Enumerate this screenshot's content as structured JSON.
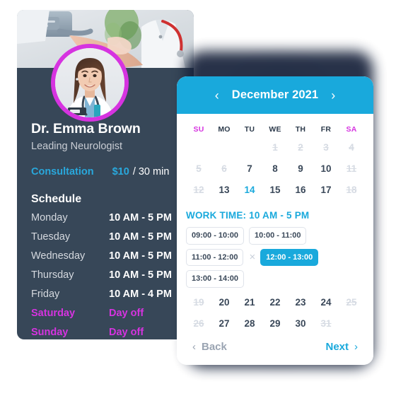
{
  "doctor": {
    "name": "Dr. Emma Brown",
    "role": "Leading Neurologist",
    "banner_alt": "doctor-measuring-blood-pressure-photo",
    "avatar_alt": "doctor-portrait-photo",
    "consultation_label": "Consultation",
    "consultation_price": "$10",
    "consultation_unit": "/ 30 min",
    "schedule_title": "Schedule",
    "schedule": [
      {
        "day": "Monday",
        "hours": "10 AM - 5 PM",
        "off": false
      },
      {
        "day": "Tuesday",
        "hours": "10 AM - 5 PM",
        "off": false
      },
      {
        "day": "Wednesday",
        "hours": "10 AM - 5 PM",
        "off": false
      },
      {
        "day": "Thursday",
        "hours": "10 AM - 5 PM",
        "off": false
      },
      {
        "day": "Friday",
        "hours": "10 AM - 4 PM",
        "off": false
      },
      {
        "day": "Saturday",
        "hours": "Day off",
        "off": true
      },
      {
        "day": "Sunday",
        "hours": "Day off",
        "off": true
      }
    ]
  },
  "calendar": {
    "title": "December 2021",
    "prev_icon": "‹",
    "next_icon": "›",
    "weekdays": [
      {
        "label": "SU",
        "weekend": true
      },
      {
        "label": "MO",
        "weekend": false
      },
      {
        "label": "TU",
        "weekend": false
      },
      {
        "label": "WE",
        "weekend": false
      },
      {
        "label": "TH",
        "weekend": false
      },
      {
        "label": "FR",
        "weekend": false
      },
      {
        "label": "SA",
        "weekend": true
      }
    ],
    "weeks_top": [
      [
        {
          "d": "",
          "state": "empty"
        },
        {
          "d": "",
          "state": "empty"
        },
        {
          "d": "",
          "state": "empty"
        },
        {
          "d": "1",
          "state": "disabled"
        },
        {
          "d": "2",
          "state": "disabled"
        },
        {
          "d": "3",
          "state": "disabled"
        },
        {
          "d": "4",
          "state": "disabled"
        }
      ],
      [
        {
          "d": "5",
          "state": "disabled"
        },
        {
          "d": "6",
          "state": "disabled"
        },
        {
          "d": "7",
          "state": "normal"
        },
        {
          "d": "8",
          "state": "normal"
        },
        {
          "d": "9",
          "state": "normal"
        },
        {
          "d": "10",
          "state": "normal"
        },
        {
          "d": "11",
          "state": "disabled"
        }
      ],
      [
        {
          "d": "12",
          "state": "disabled"
        },
        {
          "d": "13",
          "state": "normal"
        },
        {
          "d": "14",
          "state": "selected"
        },
        {
          "d": "15",
          "state": "normal"
        },
        {
          "d": "16",
          "state": "normal"
        },
        {
          "d": "17",
          "state": "normal"
        },
        {
          "d": "18",
          "state": "disabled"
        }
      ]
    ],
    "weeks_bottom": [
      [
        {
          "d": "19",
          "state": "disabled"
        },
        {
          "d": "20",
          "state": "normal"
        },
        {
          "d": "21",
          "state": "normal"
        },
        {
          "d": "22",
          "state": "normal"
        },
        {
          "d": "23",
          "state": "normal"
        },
        {
          "d": "24",
          "state": "normal"
        },
        {
          "d": "25",
          "state": "disabled"
        }
      ],
      [
        {
          "d": "26",
          "state": "disabled"
        },
        {
          "d": "27",
          "state": "normal"
        },
        {
          "d": "28",
          "state": "normal"
        },
        {
          "d": "29",
          "state": "normal"
        },
        {
          "d": "30",
          "state": "normal"
        },
        {
          "d": "31",
          "state": "disabled"
        },
        {
          "d": "",
          "state": "empty"
        }
      ]
    ],
    "worktime_label": "WORK TIME: 10 AM - 5 PM",
    "slots": [
      {
        "label": "09:00 - 10:00",
        "active": false
      },
      {
        "label": "10:00 - 11:00",
        "active": false
      },
      {
        "label": "11:00 - 12:00",
        "active": false
      },
      {
        "label": "12:00 - 13:00",
        "active": true
      },
      {
        "label": "13:00 - 14:00",
        "active": false
      }
    ],
    "slot_close_icon": "×",
    "back_label": "Back",
    "next_label": "Next",
    "back_chevron": "‹",
    "next_chevron": "›"
  },
  "colors": {
    "accent_cyan": "#19a9dc",
    "accent_magenta": "#d633e0",
    "card_dark": "#374758",
    "disabled_gray": "#d6dbe3"
  }
}
